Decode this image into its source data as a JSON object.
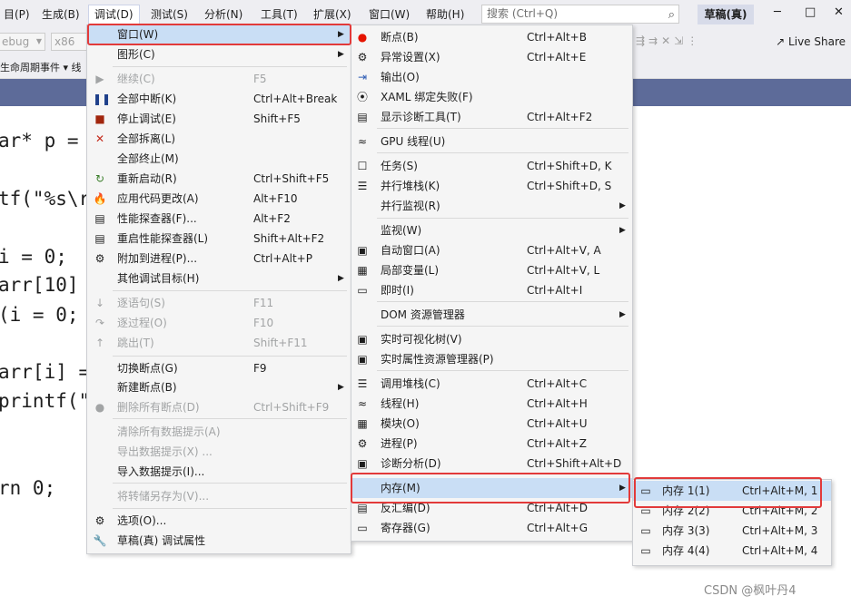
{
  "menubar": {
    "items": [
      "目(P)",
      "生成(B)",
      "调试(D)",
      "测试(S)",
      "分析(N)",
      "工具(T)",
      "扩展(X)",
      "窗口(W)",
      "帮助(H)"
    ],
    "search_placeholder": "搜索 (Ctrl+Q)",
    "draft_button": "草稿(真)"
  },
  "toolbar": {
    "config_combo": "ebug",
    "platform_combo": "x86",
    "live_share": "Live Share",
    "lifecycle_label": "生命周期事件 ▾ 线"
  },
  "code": {
    "lines": [
      "ar* p =",
      "tf(\"%s\\r",
      "i = 0;",
      "arr[10]",
      "(i = 0;",
      "arr[i] =",
      "printf(\"",
      "rn 0;"
    ]
  },
  "debug_menu": {
    "items": [
      {
        "label": "窗口(W)",
        "shortcut": "",
        "submenu": true,
        "icon": ""
      },
      {
        "label": "图形(C)",
        "shortcut": "",
        "submenu": true,
        "icon": ""
      },
      {
        "label": "继续(C)",
        "shortcut": "F5",
        "disabled": true,
        "icon": "play-icon"
      },
      {
        "label": "全部中断(K)",
        "shortcut": "Ctrl+Alt+Break",
        "icon": "pause-icon"
      },
      {
        "label": "停止调试(E)",
        "shortcut": "Shift+F5",
        "icon": "stop-icon"
      },
      {
        "label": "全部拆离(L)",
        "shortcut": "",
        "icon": "detach-icon"
      },
      {
        "label": "全部终止(M)",
        "shortcut": "",
        "icon": ""
      },
      {
        "label": "重新启动(R)",
        "shortcut": "Ctrl+Shift+F5",
        "icon": "restart-icon"
      },
      {
        "label": "应用代码更改(A)",
        "shortcut": "Alt+F10",
        "icon": "hot-reload-icon"
      },
      {
        "label": "性能探查器(F)...",
        "shortcut": "Alt+F2",
        "icon": "profiler-icon"
      },
      {
        "label": "重启性能探查器(L)",
        "shortcut": "Shift+Alt+F2",
        "icon": "profiler-restart-icon"
      },
      {
        "label": "附加到进程(P)...",
        "shortcut": "Ctrl+Alt+P",
        "icon": "attach-icon"
      },
      {
        "label": "其他调试目标(H)",
        "shortcut": "",
        "submenu": true,
        "icon": ""
      },
      {
        "label": "逐语句(S)",
        "shortcut": "F11",
        "disabled": true,
        "icon": "step-into-icon"
      },
      {
        "label": "逐过程(O)",
        "shortcut": "F10",
        "disabled": true,
        "icon": "step-over-icon"
      },
      {
        "label": "跳出(T)",
        "shortcut": "Shift+F11",
        "disabled": true,
        "icon": "step-out-icon"
      },
      {
        "label": "切换断点(G)",
        "shortcut": "F9",
        "icon": ""
      },
      {
        "label": "新建断点(B)",
        "shortcut": "",
        "submenu": true,
        "icon": ""
      },
      {
        "label": "删除所有断点(D)",
        "shortcut": "Ctrl+Shift+F9",
        "disabled": true,
        "icon": "delete-breakpoints-icon"
      },
      {
        "label": "清除所有数据提示(A)",
        "shortcut": "",
        "disabled": true,
        "icon": ""
      },
      {
        "label": "导出数据提示(X) ...",
        "shortcut": "",
        "disabled": true,
        "icon": ""
      },
      {
        "label": "导入数据提示(I)...",
        "shortcut": "",
        "icon": ""
      },
      {
        "label": "将转储另存为(V)...",
        "shortcut": "",
        "disabled": true,
        "icon": ""
      },
      {
        "label": "选项(O)...",
        "shortcut": "",
        "icon": "gear-icon"
      },
      {
        "label": "草稿(真) 调试属性",
        "shortcut": "",
        "icon": "wrench-icon"
      }
    ]
  },
  "window_menu": {
    "items": [
      {
        "label": "断点(B)",
        "shortcut": "Ctrl+Alt+B",
        "icon": "breakpoint-icon"
      },
      {
        "label": "异常设置(X)",
        "shortcut": "Ctrl+Alt+E",
        "icon": "exception-icon"
      },
      {
        "label": "输出(O)",
        "shortcut": "",
        "icon": "output-icon"
      },
      {
        "label": "XAML 绑定失败(F)",
        "shortcut": "",
        "icon": "xaml-icon"
      },
      {
        "label": "显示诊断工具(T)",
        "shortcut": "Ctrl+Alt+F2",
        "icon": "diagnostics-icon"
      },
      {
        "label": "GPU 线程(U)",
        "shortcut": "",
        "icon": "gpu-threads-icon"
      },
      {
        "label": "任务(S)",
        "shortcut": "Ctrl+Shift+D, K",
        "icon": "tasks-icon"
      },
      {
        "label": "并行堆栈(K)",
        "shortcut": "Ctrl+Shift+D, S",
        "icon": "parallel-stacks-icon"
      },
      {
        "label": "并行监视(R)",
        "shortcut": "",
        "submenu": true,
        "icon": ""
      },
      {
        "label": "监视(W)",
        "shortcut": "",
        "submenu": true,
        "icon": ""
      },
      {
        "label": "自动窗口(A)",
        "shortcut": "Ctrl+Alt+V, A",
        "icon": "autos-icon"
      },
      {
        "label": "局部变量(L)",
        "shortcut": "Ctrl+Alt+V, L",
        "icon": "locals-icon"
      },
      {
        "label": "即时(I)",
        "shortcut": "Ctrl+Alt+I",
        "icon": "immediate-icon"
      },
      {
        "label": "DOM 资源管理器",
        "shortcut": "",
        "submenu": true,
        "icon": ""
      },
      {
        "label": "实时可视化树(V)",
        "shortcut": "",
        "icon": "camera-icon"
      },
      {
        "label": "实时属性资源管理器(P)",
        "shortcut": "",
        "icon": "camera-icon"
      },
      {
        "label": "调用堆栈(C)",
        "shortcut": "Ctrl+Alt+C",
        "icon": "call-stack-icon"
      },
      {
        "label": "线程(H)",
        "shortcut": "Ctrl+Alt+H",
        "icon": "threads-icon"
      },
      {
        "label": "模块(O)",
        "shortcut": "Ctrl+Alt+U",
        "icon": "modules-icon"
      },
      {
        "label": "进程(P)",
        "shortcut": "Ctrl+Alt+Z",
        "icon": "processes-icon"
      },
      {
        "label": "诊断分析(D)",
        "shortcut": "Ctrl+Shift+Alt+D",
        "icon": "analysis-icon"
      },
      {
        "label": "内存(M)",
        "shortcut": "",
        "submenu": true,
        "icon": ""
      },
      {
        "label": "反汇编(D)",
        "shortcut": "Ctrl+Alt+D",
        "icon": "disassembly-icon"
      },
      {
        "label": "寄存器(G)",
        "shortcut": "Ctrl+Alt+G",
        "icon": "registers-icon"
      }
    ]
  },
  "memory_menu": {
    "items": [
      {
        "label": "内存 1(1)",
        "shortcut": "Ctrl+Alt+M, 1"
      },
      {
        "label": "内存 2(2)",
        "shortcut": "Ctrl+Alt+M, 2"
      },
      {
        "label": "内存 3(3)",
        "shortcut": "Ctrl+Alt+M, 3"
      },
      {
        "label": "内存 4(4)",
        "shortcut": "Ctrl+Alt+M, 4"
      }
    ]
  },
  "watermark": "CSDN @枫叶丹4"
}
